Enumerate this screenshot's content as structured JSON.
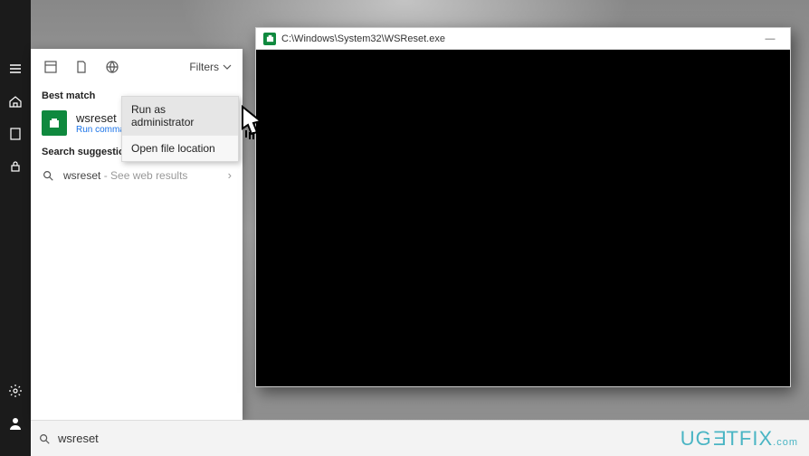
{
  "left_rail": {
    "items_top": [
      "menu",
      "home",
      "tablet",
      "lock"
    ],
    "items_bottom": [
      "settings",
      "user"
    ]
  },
  "search": {
    "filters_label": "Filters",
    "best_match_header": "Best match",
    "best_match": {
      "name": "wsreset",
      "subtitle": "Run command"
    },
    "context_menu": {
      "run_admin": "Run as administrator",
      "open_location": "Open file location"
    },
    "suggestions_header": "Search suggestions",
    "suggestion": {
      "term": "wsreset",
      "subtitle": "See web results"
    }
  },
  "console": {
    "title": "C:\\Windows\\System32\\WSReset.exe"
  },
  "taskbar": {
    "search_value": "wsreset"
  },
  "watermark": {
    "text": "UGETFIX",
    "suffix": ".com"
  }
}
